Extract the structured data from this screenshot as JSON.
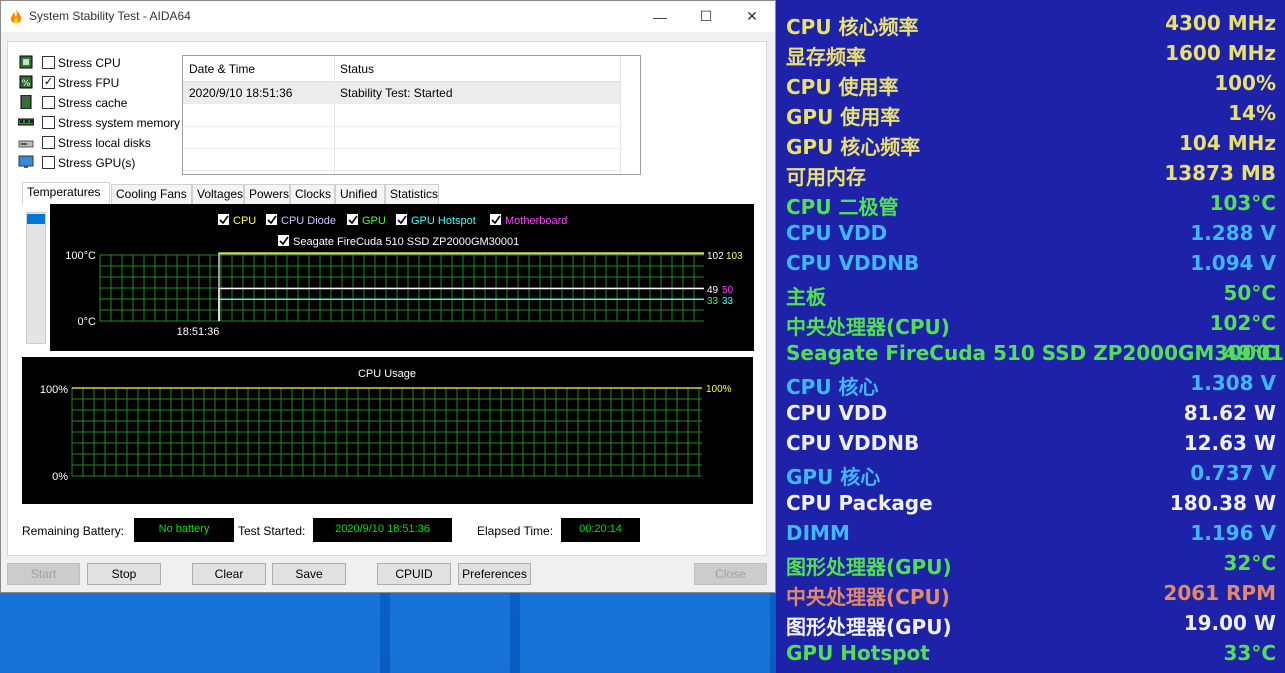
{
  "window": {
    "title": "System Stability Test - AIDA64",
    "minimize": "—",
    "maximize": "☐",
    "close": "✕"
  },
  "stress": [
    {
      "label": "Stress CPU",
      "checked": false,
      "icon": "cpu-chip-icon"
    },
    {
      "label": "Stress FPU",
      "checked": true,
      "icon": "fpu-percent-icon"
    },
    {
      "label": "Stress cache",
      "checked": false,
      "icon": "cache-chip-icon"
    },
    {
      "label": "Stress system memory",
      "checked": false,
      "icon": "memory-module-icon"
    },
    {
      "label": "Stress local disks",
      "checked": false,
      "icon": "disk-drive-icon"
    },
    {
      "label": "Stress GPU(s)",
      "checked": false,
      "icon": "monitor-icon"
    }
  ],
  "status_table": {
    "headers": [
      "Date & Time",
      "Status"
    ],
    "rows": [
      {
        "datetime": "2020/9/10 18:51:36",
        "status": "Stability Test: Started"
      }
    ]
  },
  "tabs": [
    "Temperatures",
    "Cooling Fans",
    "Voltages",
    "Powers",
    "Clocks",
    "Unified",
    "Statistics"
  ],
  "active_tab": "Temperatures",
  "temp_chart": {
    "legend": [
      {
        "label": "CPU",
        "color": "#ffff40",
        "checked": true
      },
      {
        "label": "CPU Diode",
        "color": "#c8c8ff",
        "checked": true
      },
      {
        "label": "GPU",
        "color": "#40ff40",
        "checked": true
      },
      {
        "label": "GPU Hotspot",
        "color": "#40ffff",
        "checked": true
      },
      {
        "label": "Motherboard",
        "color": "#ff40ff",
        "checked": true
      },
      {
        "label": "Seagate FireCuda 510 SSD ZP2000GM30001",
        "color": "#ffffff",
        "checked": true
      }
    ],
    "y_max_label": "100°C",
    "y_min_label": "0°C",
    "x_label": "18:51:36",
    "right_labels": [
      {
        "text": "102",
        "color": "#ffffff"
      },
      {
        "text": "103",
        "color": "#ffff40"
      },
      {
        "text": "49",
        "color": "#ffffff"
      },
      {
        "text": "50",
        "color": "#ff40ff"
      },
      {
        "text": "33",
        "color": "#40ff40"
      },
      {
        "text": "33",
        "color": "#40ffff"
      }
    ]
  },
  "chart_data": [
    {
      "type": "line",
      "ylim": [
        0,
        100
      ],
      "series": [
        {
          "name": "CPU",
          "values": [
            103
          ]
        },
        {
          "name": "CPU Diode",
          "values": [
            102
          ]
        },
        {
          "name": "GPU",
          "values": [
            33
          ]
        },
        {
          "name": "GPU Hotspot",
          "values": [
            33
          ]
        },
        {
          "name": "Motherboard",
          "values": [
            50
          ]
        },
        {
          "name": "Seagate FireCuda 510 SSD ZP2000GM30001",
          "values": [
            49
          ]
        }
      ]
    },
    {
      "type": "line",
      "title": "CPU Usage",
      "ylim": [
        0,
        100
      ],
      "series": [
        {
          "name": "",
          "values": [
            100
          ]
        }
      ]
    }
  ],
  "usage_chart": {
    "title": "CPU Usage",
    "y_max_label": "100%",
    "y_min_label": "0%",
    "right_label": "100%"
  },
  "bottom": {
    "battery_label": "Remaining Battery:",
    "battery_value": "No battery",
    "started_label": "Test Started:",
    "started_value": "2020/9/10 18:51:36",
    "elapsed_label": "Elapsed Time:",
    "elapsed_value": "00:20:14"
  },
  "buttons": {
    "start": "Start",
    "stop": "Stop",
    "clear": "Clear",
    "save": "Save",
    "cpuid": "CPUID",
    "preferences": "Preferences",
    "close": "Close"
  },
  "osd": [
    {
      "label": "CPU 核心频率",
      "value": "4300 MHz",
      "color": "#e8e070"
    },
    {
      "label": "显存频率",
      "value": "1600 MHz",
      "color": "#e8e070"
    },
    {
      "label": "CPU 使用率",
      "value": "100%",
      "color": "#e8e070"
    },
    {
      "label": "GPU 使用率",
      "value": "14%",
      "color": "#e8e070"
    },
    {
      "label": "GPU 核心频率",
      "value": "104 MHz",
      "color": "#e8e070"
    },
    {
      "label": "可用内存",
      "value": "13873 MB",
      "color": "#e8e070"
    },
    {
      "label": "CPU 二极管",
      "value": "103°C",
      "color": "#52e052"
    },
    {
      "label": "CPU VDD",
      "value": "1.288 V",
      "color": "#3fb8ff"
    },
    {
      "label": "CPU VDDNB",
      "value": "1.094 V",
      "color": "#3fb8ff"
    },
    {
      "label": "主板",
      "value": "50°C",
      "color": "#52e052"
    },
    {
      "label": "中央处理器(CPU)",
      "value": "102°C",
      "color": "#52e052"
    },
    {
      "label": "Seagate FireCuda 510 SSD ZP2000GM30001",
      "value": "49°C",
      "color": "#52e052"
    },
    {
      "label": "CPU 核心",
      "value": "1.308 V",
      "color": "#3fb8ff"
    },
    {
      "label": "CPU VDD",
      "value": "81.62 W",
      "color": "#f0f0f0"
    },
    {
      "label": "CPU VDDNB",
      "value": "12.63 W",
      "color": "#f0f0f0"
    },
    {
      "label": "GPU 核心",
      "value": "0.737 V",
      "color": "#3fb8ff"
    },
    {
      "label": "CPU Package",
      "value": "180.38 W",
      "color": "#f0f0f0"
    },
    {
      "label": "DIMM",
      "value": "1.196 V",
      "color": "#3fb8ff"
    },
    {
      "label": "图形处理器(GPU)",
      "value": "32°C",
      "color": "#52e052"
    },
    {
      "label": "中央处理器(CPU)",
      "value": "2061 RPM",
      "color": "#e08a6a"
    },
    {
      "label": "图形处理器(GPU)",
      "value": "19.00 W",
      "color": "#f0f0f0"
    },
    {
      "label": "GPU Hotspot",
      "value": "33°C",
      "color": "#52e052"
    }
  ]
}
